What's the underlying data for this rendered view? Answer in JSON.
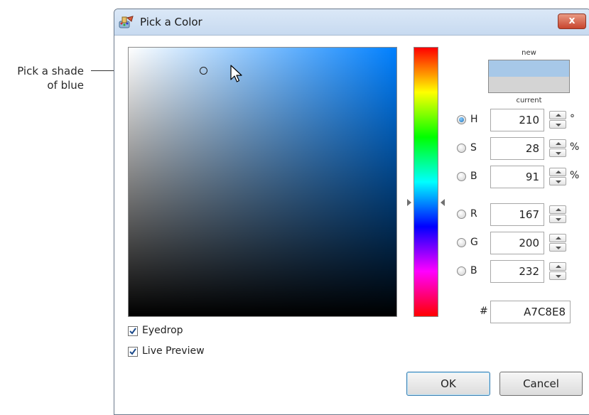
{
  "annotation": {
    "line1": "Pick a shade",
    "line2": "of blue"
  },
  "dialog": {
    "title": "Pick a Color",
    "close_label": "x"
  },
  "swatch": {
    "new_label": "new",
    "current_label": "current",
    "new_color": "#A7C8E8",
    "current_color": "#D4D4D4"
  },
  "fields": [
    {
      "label": "H",
      "value": "210",
      "unit": "°",
      "checked": true
    },
    {
      "label": "S",
      "value": "28",
      "unit": "%",
      "checked": false
    },
    {
      "label": "B",
      "value": "91",
      "unit": "%",
      "checked": false
    },
    {
      "label": "R",
      "value": "167",
      "unit": "",
      "checked": false
    },
    {
      "label": "G",
      "value": "200",
      "unit": "",
      "checked": false
    },
    {
      "label": "B",
      "value": "232",
      "unit": "",
      "checked": false
    }
  ],
  "hex": {
    "prefix": "#",
    "value": "A7C8E8"
  },
  "options": {
    "eyedrop_label": "Eyedrop",
    "eyedrop_checked": true,
    "live_preview_label": "Live Preview",
    "live_preview_checked": true
  },
  "buttons": {
    "ok_label": "OK",
    "cancel_label": "Cancel"
  }
}
